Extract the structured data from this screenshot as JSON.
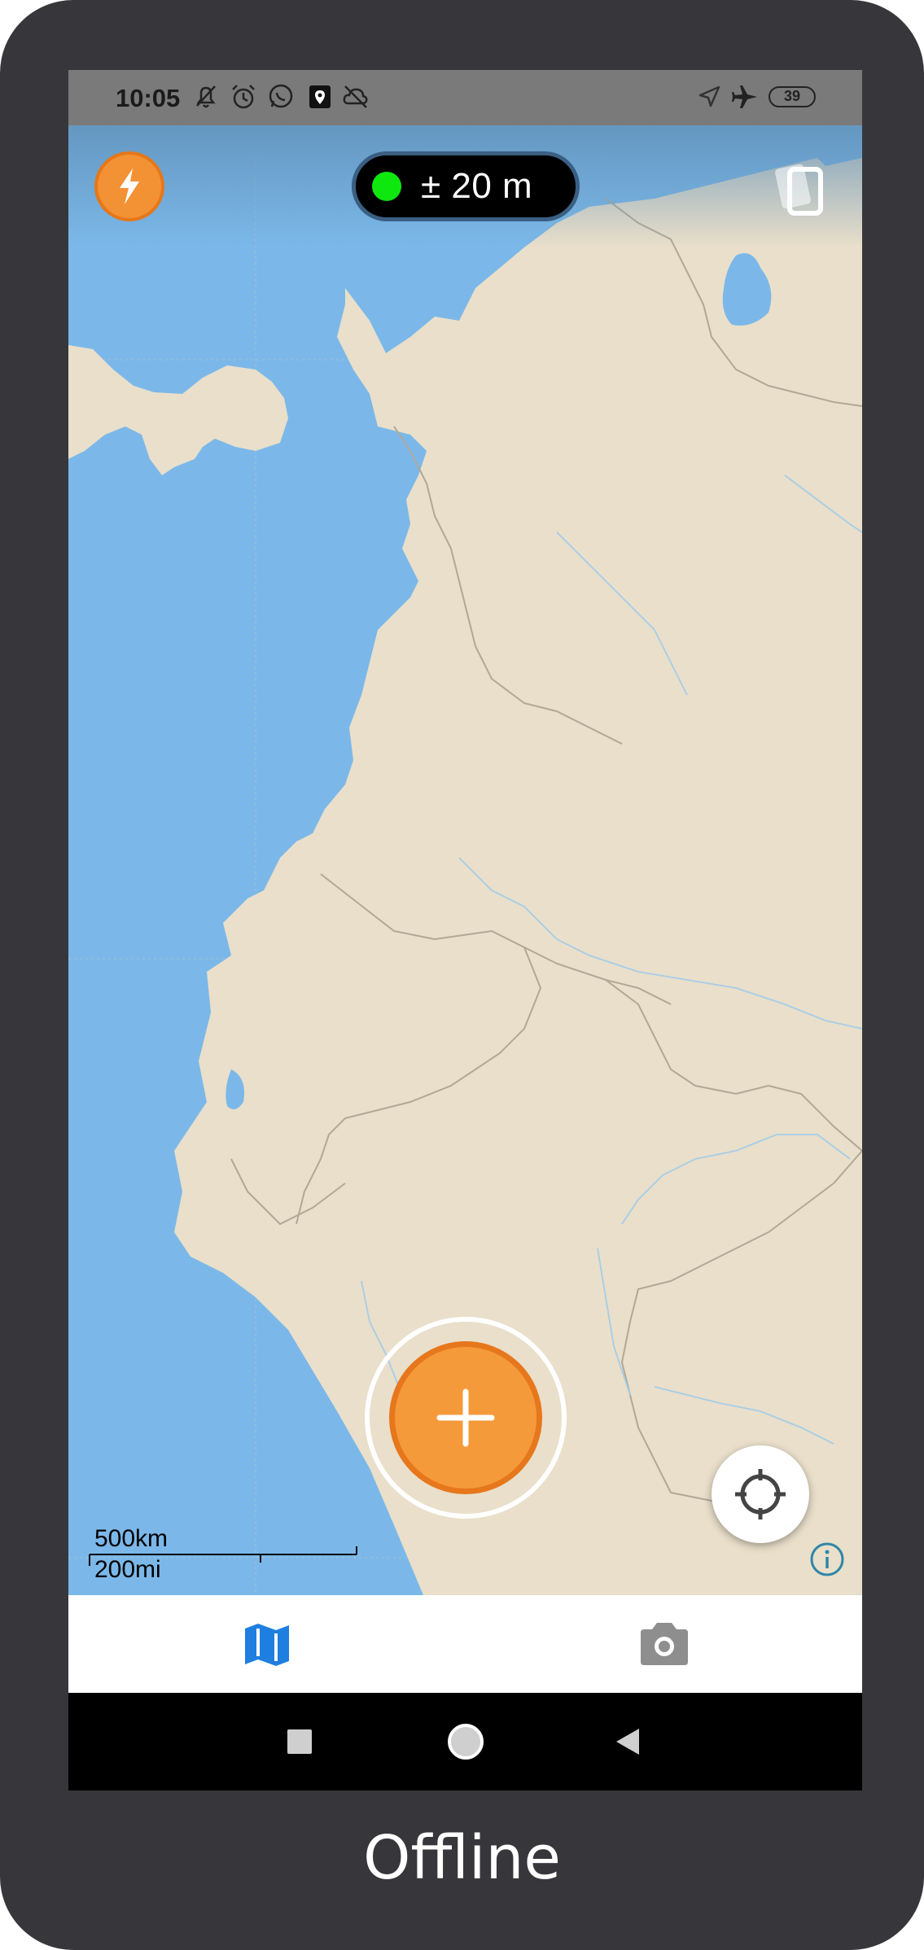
{
  "status_bar": {
    "time": "10:05",
    "battery": "39",
    "left_icons": [
      "bell-off-icon",
      "alarm-icon",
      "whatsapp-icon",
      "location-app-icon",
      "cloud-off-icon"
    ],
    "right_icons": [
      "navigation-icon",
      "airplane-mode-icon",
      "battery-icon"
    ]
  },
  "map": {
    "accuracy_text": "± 20 m",
    "accuracy_status_color": "#0ee80e",
    "water_color": "#7bb8e9",
    "land_color": "#e9dfca",
    "scale": {
      "metric_label": "500km",
      "imperial_label": "200mi"
    }
  },
  "controls": {
    "flash_icon": "lightning-icon",
    "layers_icon": "layers-icon",
    "add_icon": "plus-icon",
    "locate_icon": "crosshair-icon",
    "info_icon": "info-icon",
    "accent_color": "#f59a3a"
  },
  "bottom_nav": {
    "tabs": [
      {
        "icon": "map-icon",
        "active": true
      },
      {
        "icon": "camera-icon",
        "active": false
      }
    ]
  },
  "system_nav": [
    "recents-button",
    "home-button",
    "back-button"
  ],
  "caption": "Offline"
}
